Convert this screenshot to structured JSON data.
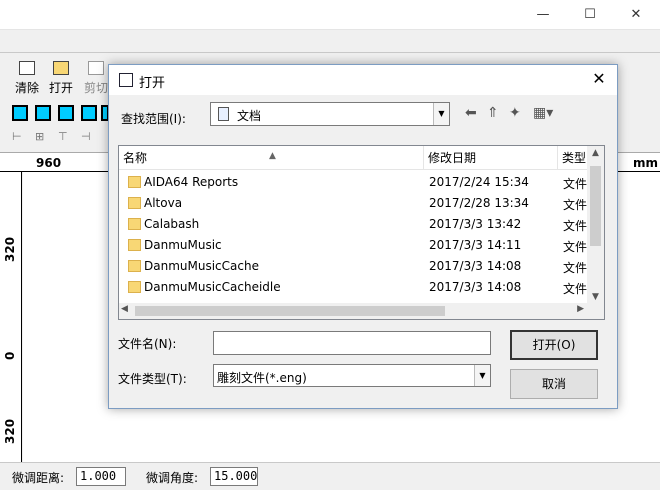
{
  "main_toolbar": {
    "clear_label": "清除",
    "open_label": "打开",
    "cut_label": "剪切"
  },
  "ruler": {
    "top_number": "960",
    "unit": "mm",
    "left_numbers": [
      "320",
      "0",
      "320"
    ]
  },
  "status": {
    "nudge_distance_label": "微调距离:",
    "nudge_distance_value": "1.000",
    "nudge_angle_label": "微调角度:",
    "nudge_angle_value": "15.000"
  },
  "dialog": {
    "title": "打开",
    "look_in_label": "查找范围(I):",
    "look_in_value": "文档",
    "columns": {
      "name": "名称",
      "date": "修改日期",
      "type": "类型"
    },
    "files": [
      {
        "name": "AIDA64 Reports",
        "date": "2017/2/24 15:34",
        "type": "文件"
      },
      {
        "name": "Altova",
        "date": "2017/2/28 13:34",
        "type": "文件"
      },
      {
        "name": "Calabash",
        "date": "2017/3/3 13:42",
        "type": "文件"
      },
      {
        "name": "DanmuMusic",
        "date": "2017/3/3 14:11",
        "type": "文件"
      },
      {
        "name": "DanmuMusicCache",
        "date": "2017/3/3 14:08",
        "type": "文件"
      },
      {
        "name": "DanmuMusicCacheidle",
        "date": "2017/3/3 14:08",
        "type": "文件"
      }
    ],
    "filename_label": "文件名(N):",
    "filename_value": "",
    "filetype_label": "文件类型(T):",
    "filetype_value": "雕刻文件(*.eng)",
    "open_button": "打开(O)",
    "cancel_button": "取消"
  }
}
